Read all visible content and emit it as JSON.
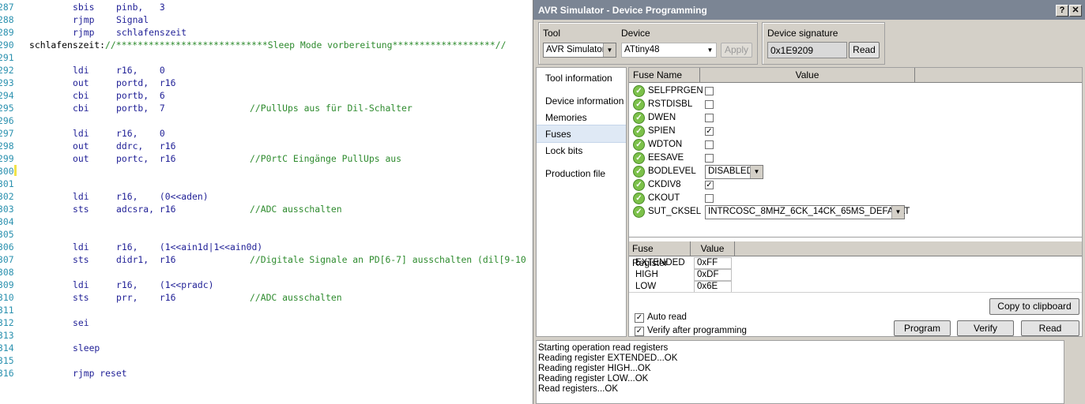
{
  "editor": {
    "lines": [
      {
        "num": "287",
        "instr": "sbis",
        "args": "pinb,   3"
      },
      {
        "num": "288",
        "instr": "rjmp",
        "args": "Signal"
      },
      {
        "num": "289",
        "instr": "rjmp",
        "args": "schlafenszeit"
      },
      {
        "num": "290",
        "label": "schlafenszeit:",
        "stars": "//****************************Sleep Mode vorbereitung*******************//"
      },
      {
        "num": "291"
      },
      {
        "num": "292",
        "instr": "ldi",
        "args": "r16,    0"
      },
      {
        "num": "293",
        "instr": "out",
        "args": "portd,  r16"
      },
      {
        "num": "294",
        "instr": "cbi",
        "args": "portb,  6"
      },
      {
        "num": "295",
        "instr": "cbi",
        "args": "portb,  7",
        "comment": "//PullUps aus für Dil-Schalter"
      },
      {
        "num": "296"
      },
      {
        "num": "297",
        "instr": "ldi",
        "args": "r16,    0"
      },
      {
        "num": "298",
        "instr": "out",
        "args": "ddrc,   r16"
      },
      {
        "num": "299",
        "instr": "out",
        "args": "portc,  r16",
        "comment": "//P0rtC Eingänge PullUps aus"
      },
      {
        "num": "300"
      },
      {
        "num": "301"
      },
      {
        "num": "302",
        "instr": "ldi",
        "args": "r16,    (0<<aden)"
      },
      {
        "num": "303",
        "instr": "sts",
        "args": "adcsra, r16",
        "comment": "//ADC ausschalten"
      },
      {
        "num": "304"
      },
      {
        "num": "305"
      },
      {
        "num": "306",
        "instr": "ldi",
        "args": "r16,    (1<<ain1d|1<<ain0d)"
      },
      {
        "num": "307",
        "instr": "sts",
        "args": "didr1,  r16",
        "comment": "//Digitale Signale an PD[6-7] ausschalten (dil[9-10"
      },
      {
        "num": "308"
      },
      {
        "num": "309",
        "instr": "ldi",
        "args": "r16,    (1<<pradc)"
      },
      {
        "num": "310",
        "instr": "sts",
        "args": "prr,    r16",
        "comment": "//ADC ausschalten"
      },
      {
        "num": "311"
      },
      {
        "num": "312",
        "instr": "sei"
      },
      {
        "num": "313"
      },
      {
        "num": "314",
        "instr": "sleep"
      },
      {
        "num": "315"
      },
      {
        "num": "316",
        "instr": "rjmp reset"
      }
    ]
  },
  "dialog": {
    "title": "AVR Simulator - Device Programming",
    "help_btn": "?",
    "close_btn": "✕",
    "tool_label": "Tool",
    "tool_value": "AVR Simulator",
    "device_label": "Device",
    "device_value": "ATtiny48",
    "apply_label": "Apply",
    "signature_label": "Device signature",
    "signature_value": "0x1E9209",
    "signature_read": "Read",
    "nav": [
      "Tool information",
      "Device information",
      "Memories",
      "Fuses",
      "Lock bits",
      "Production file"
    ],
    "fuse_name_header": "Fuse Name",
    "value_header": "Value",
    "fuses": [
      {
        "name": "SELFPRGEN",
        "type": "check",
        "checked": false
      },
      {
        "name": "RSTDISBL",
        "type": "check",
        "checked": false
      },
      {
        "name": "DWEN",
        "type": "check",
        "checked": false
      },
      {
        "name": "SPIEN",
        "type": "check",
        "checked": true
      },
      {
        "name": "WDTON",
        "type": "check",
        "checked": false
      },
      {
        "name": "EESAVE",
        "type": "check",
        "checked": false
      },
      {
        "name": "BODLEVEL",
        "type": "combo",
        "value": "DISABLED"
      },
      {
        "name": "CKDIV8",
        "type": "check",
        "checked": true
      },
      {
        "name": "CKOUT",
        "type": "check",
        "checked": false
      },
      {
        "name": "SUT_CKSEL",
        "type": "combo",
        "value": "INTRCOSC_8MHZ_6CK_14CK_65MS_DEFAULT"
      }
    ],
    "register_header": "Fuse Register",
    "register_value_header": "Value",
    "registers": [
      {
        "name": "EXTENDED",
        "value": "0xFF"
      },
      {
        "name": "HIGH",
        "value": "0xDF"
      },
      {
        "name": "LOW",
        "value": "0x6E"
      }
    ],
    "auto_read_label": "Auto read",
    "verify_label": "Verify after programming",
    "copy_btn": "Copy to clipboard",
    "program_btn": "Program",
    "verify_btn": "Verify",
    "read_btn": "Read",
    "log": [
      "Starting operation read registers",
      "Reading register EXTENDED...OK",
      "Reading register HIGH...OK",
      "Reading register LOW...OK",
      "Read registers...OK"
    ]
  }
}
